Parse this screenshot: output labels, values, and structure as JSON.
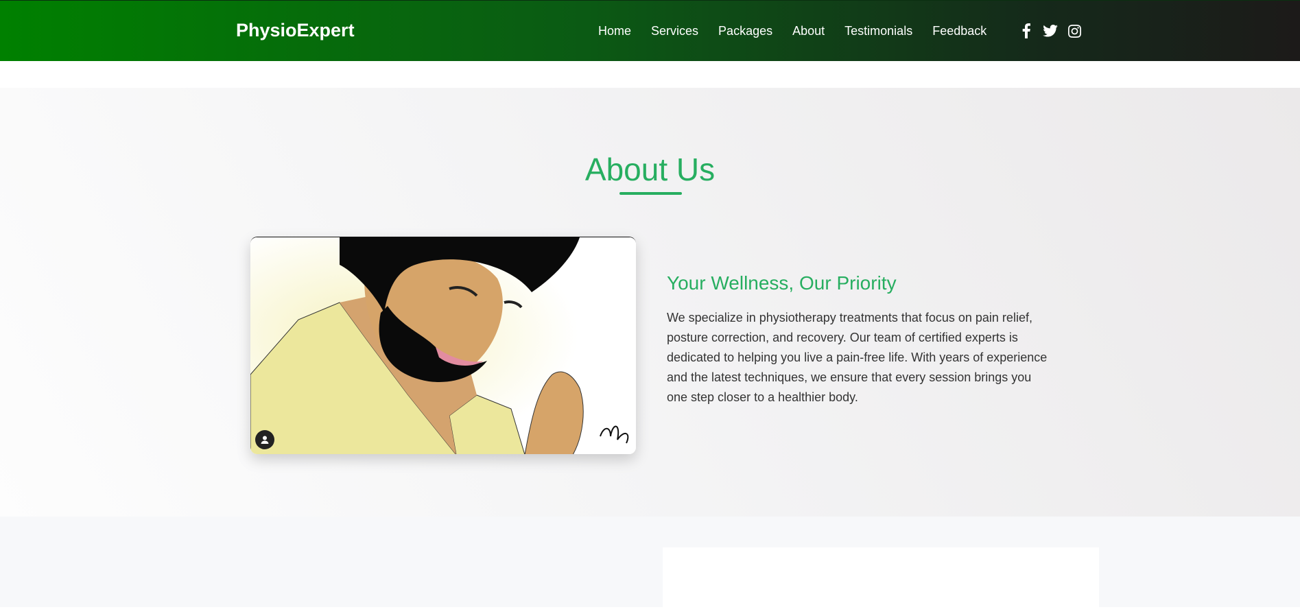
{
  "header": {
    "logo": "PhysioExpert",
    "nav": [
      "Home",
      "Services",
      "Packages",
      "About",
      "Testimonials",
      "Feedback"
    ],
    "social_icons": [
      "facebook-icon",
      "twitter-icon",
      "instagram-icon"
    ]
  },
  "about": {
    "title": "About Us",
    "subtitle": "Your Wellness, Our Priority",
    "description": "We specialize in physiotherapy treatments that focus on pain relief, posture correction, and recovery. Our team of certified experts is dedicated to helping you live a pain-free life. With years of experience and the latest techniques, we ensure that every session brings you one step closer to a healthier body.",
    "image": "illustration of a bearded man in a yellow shirt looking down at his hand"
  },
  "colors": {
    "accent": "#27ae60",
    "header_gradient_start": "#008000",
    "header_gradient_end": "#1c1a19",
    "text": "#333333"
  }
}
